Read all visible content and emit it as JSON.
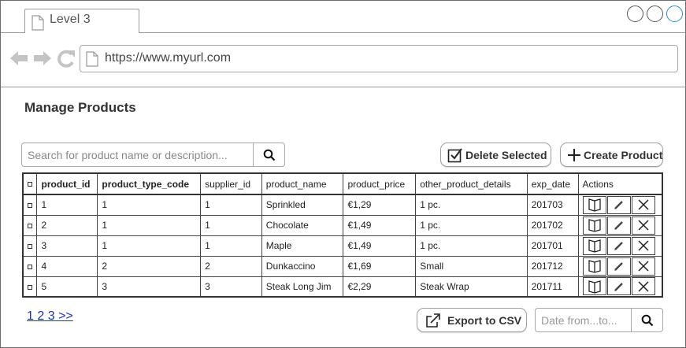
{
  "browser": {
    "tab_title": "Level 3",
    "url": "https://www.myurl.com"
  },
  "page": {
    "title": "Manage Products"
  },
  "search": {
    "placeholder": "Search for product name or description..."
  },
  "toolbar": {
    "delete_label": "Delete Selected",
    "create_label": "Create Product"
  },
  "table": {
    "columns": [
      "product_id",
      "product_type_code",
      "supplier_id",
      "product_name",
      "product_price",
      "other_product_details",
      "exp_date",
      "Actions"
    ],
    "rows": [
      [
        "1",
        "1",
        "1",
        "Sprinkled",
        "€1,29",
        "1 pc.",
        "201703"
      ],
      [
        "2",
        "1",
        "1",
        "Chocolate",
        "€1,49",
        "1 pc.",
        "201702"
      ],
      [
        "3",
        "1",
        "1",
        "Maple",
        "€1,49",
        "1 pc.",
        "201701"
      ],
      [
        "4",
        "2",
        "2",
        "Dunkaccino",
        "€1,69",
        "Small",
        "201712"
      ],
      [
        "5",
        "3",
        "3",
        "Steak Long Jim",
        "€2,29",
        "Steak Wrap",
        "201711"
      ]
    ]
  },
  "pagination": {
    "pages": [
      "1",
      "2",
      "3"
    ],
    "next": ">>"
  },
  "footer": {
    "export_label": "Export to CSV",
    "date_placeholder": "Date from...to..."
  },
  "colors": {
    "link": "#1133cc",
    "active_window_control": "#1e8fd9"
  }
}
